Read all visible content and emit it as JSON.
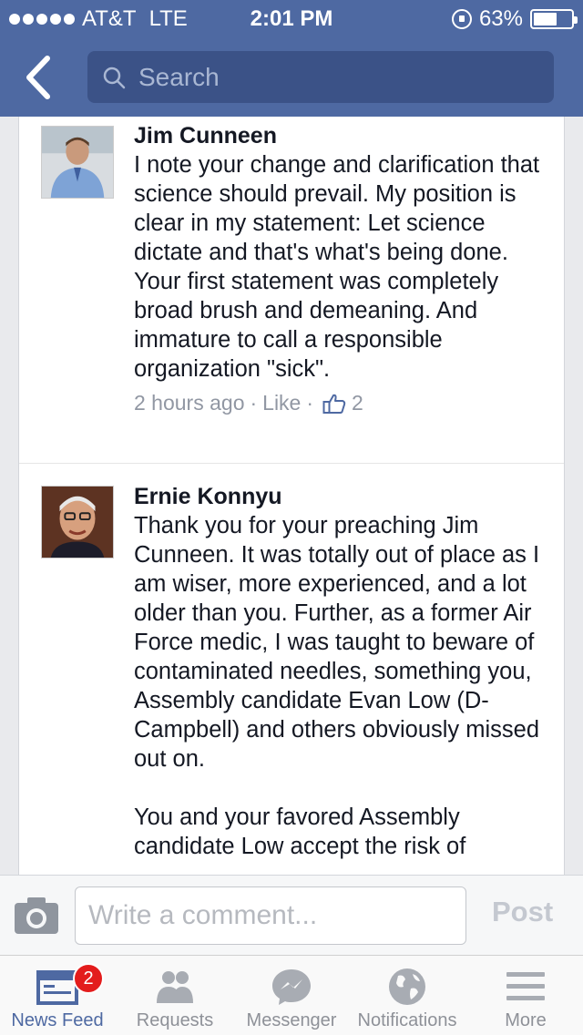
{
  "status_bar": {
    "carrier": "AT&T",
    "network": "LTE",
    "time": "2:01 PM",
    "battery": "63%",
    "battery_level": 0.63
  },
  "header": {
    "search_placeholder": "Search"
  },
  "comments": [
    {
      "author": "Jim Cunneen",
      "text": "I note your change and clarification that science should prevail. My position is clear in my statement: Let science dictate and that's what's being done. Your first statement was completely broad brush and demeaning. And immature to call a responsible organization \"sick\".",
      "time": "2 hours ago",
      "like_label": "Like",
      "like_count": "2"
    },
    {
      "author": "Ernie Konnyu",
      "text": "Thank you for your preaching Jim Cunneen. It was totally out of place as I am wiser, more experienced, and a lot older than you. Further, as a former Air Force medic, I was taught to beware of contaminated needles, something you, Assembly candidate Evan Low (D-Campbell) and others obviously missed out on.\n\nYou and your favored Assembly candidate Low accept the risk of"
    }
  ],
  "composer": {
    "placeholder": "Write a comment...",
    "post_label": "Post"
  },
  "tabbar": {
    "tabs": [
      {
        "label": "News Feed",
        "icon": "news-feed-icon",
        "badge": "2",
        "active": true
      },
      {
        "label": "Requests",
        "icon": "friend-requests-icon"
      },
      {
        "label": "Messenger",
        "icon": "messenger-icon"
      },
      {
        "label": "Notifications",
        "icon": "globe-icon"
      },
      {
        "label": "More",
        "icon": "menu-icon"
      }
    ]
  },
  "colors": {
    "header_blue": "#4e69a2",
    "active_tab": "#4e69a2",
    "badge_red": "#e31c1c"
  }
}
